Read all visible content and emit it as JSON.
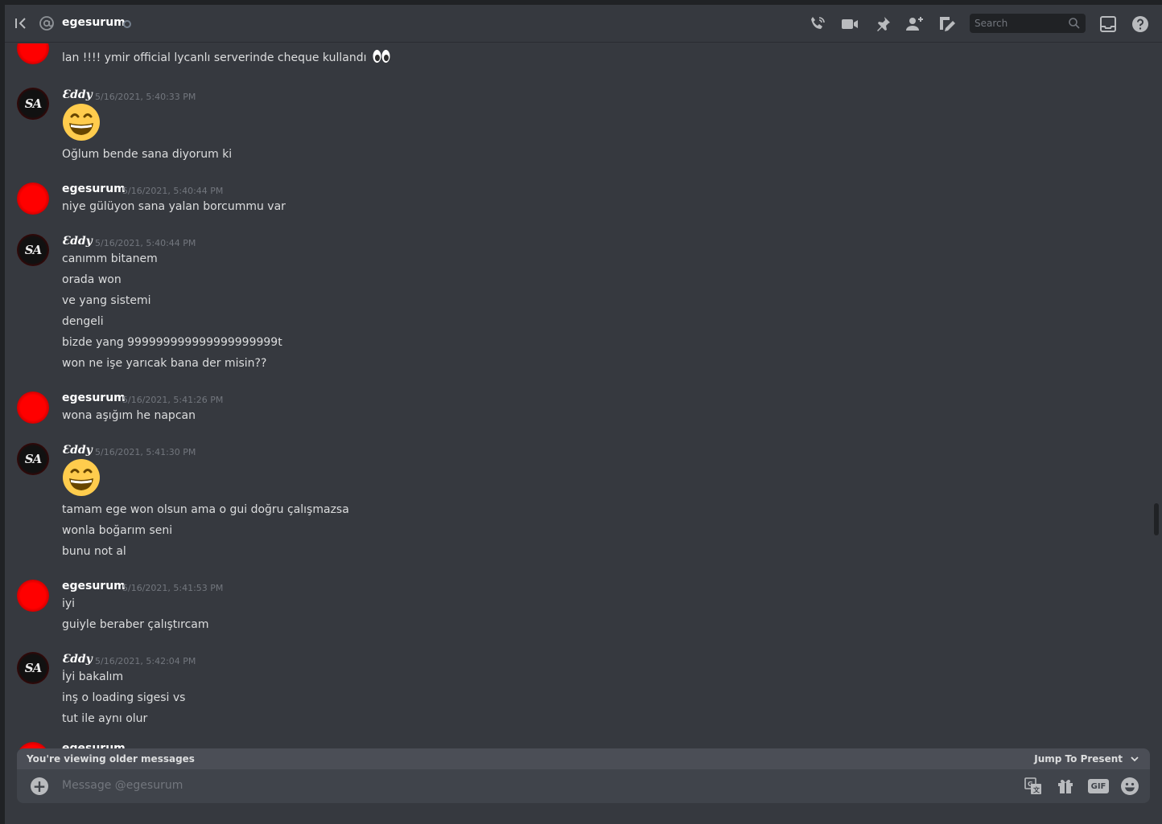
{
  "header": {
    "channel_name": "egesurum",
    "search_placeholder": "Search"
  },
  "messages": {
    "m0": {
      "text": "lan !!!! ymir official lycanlı serverinde cheque kullandı"
    },
    "m1": {
      "author": "Ɛddy",
      "timestamp": "5/16/2021, 5:40:33 PM",
      "lines": [
        "Oğlum bende sana diyorum ki"
      ]
    },
    "m2": {
      "author": "egesurum",
      "timestamp": "5/16/2021, 5:40:44 PM",
      "lines": [
        "niye gülüyon sana yalan borcummu var"
      ]
    },
    "m3": {
      "author": "Ɛddy",
      "timestamp": "5/16/2021, 5:40:44 PM",
      "lines": [
        "canımm bitanem",
        "orada won",
        "ve yang sistemi",
        "dengeli",
        "bizde yang 999999999999999999999t",
        "won ne işe yarıcak bana der misin??"
      ]
    },
    "m4": {
      "author": "egesurum",
      "timestamp": "5/16/2021, 5:41:26 PM",
      "lines": [
        "wona aşığım he napcan"
      ]
    },
    "m5": {
      "author": "Ɛddy",
      "timestamp": "5/16/2021, 5:41:30 PM",
      "lines": [
        "tamam ege won olsun ama o gui doğru çalışmazsa",
        "wonla boğarım seni",
        "bunu not al"
      ]
    },
    "m6": {
      "author": "egesurum",
      "timestamp": "5/16/2021, 5:41:53 PM",
      "lines": [
        "iyi",
        "guiyle beraber çalıştırcam"
      ]
    },
    "m7": {
      "author": "Ɛddy",
      "timestamp": "5/16/2021, 5:42:04 PM",
      "lines": [
        "İyi bakalım",
        "inş o loading sigesi vs",
        "tut ile aynı olur"
      ]
    },
    "m8": {
      "author": "egesurum"
    }
  },
  "older_bar": {
    "text": "You're viewing older messages",
    "jump_label": "Jump To Present"
  },
  "composer": {
    "placeholder": "Message @egesurum",
    "gif_label": "GIF"
  },
  "colors": {
    "background": "#36393f",
    "composer": "#40444b",
    "older_bar": "#4b4e56",
    "timestamp": "#72767d"
  },
  "icons": [
    "back-icon",
    "at-icon",
    "call-icon",
    "video-icon",
    "pin-icon",
    "add-friend-icon",
    "inbox-icon",
    "help-icon",
    "search-icon",
    "plus-icon",
    "translate-icon",
    "gift-icon",
    "emoji-icon",
    "chevron-down-icon"
  ]
}
